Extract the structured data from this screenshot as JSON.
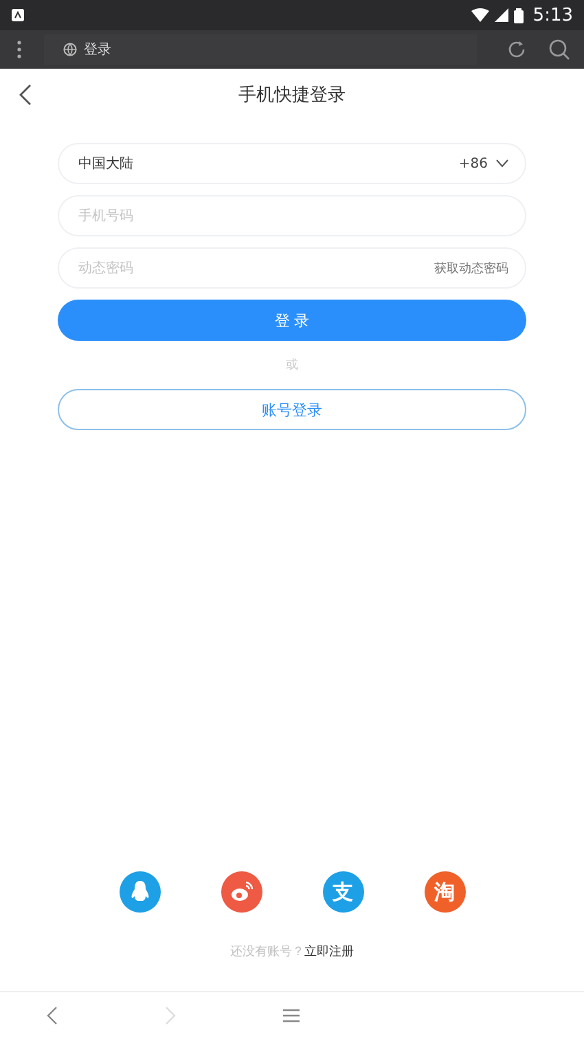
{
  "status_bar": {
    "time": "5:13"
  },
  "browser_bar": {
    "url_title": "登录"
  },
  "header": {
    "title": "手机快捷登录"
  },
  "form": {
    "region": {
      "value": "中国大陆",
      "code": "+86"
    },
    "phone": {
      "placeholder": "手机号码"
    },
    "code": {
      "placeholder": "动态密码",
      "action": "获取动态密码"
    },
    "login_button": "登 录",
    "or_text": "或",
    "account_button": "账号登录"
  },
  "social": [
    {
      "kind": "penguin",
      "color": "#1ea0e6"
    },
    {
      "kind": "eye",
      "color": "#ee5a43"
    },
    {
      "kind": "glyph",
      "glyph": "支",
      "color": "#1ea0e6"
    },
    {
      "kind": "glyph",
      "glyph": "淘",
      "color": "#f0612a"
    }
  ],
  "register": {
    "prompt": "还没有账号？",
    "link": "立即注册"
  },
  "nav_bar": {
    "items": [
      {
        "kind": "back",
        "disabled": false
      },
      {
        "kind": "forward",
        "disabled": true
      },
      {
        "kind": "menu",
        "disabled": false
      }
    ]
  }
}
